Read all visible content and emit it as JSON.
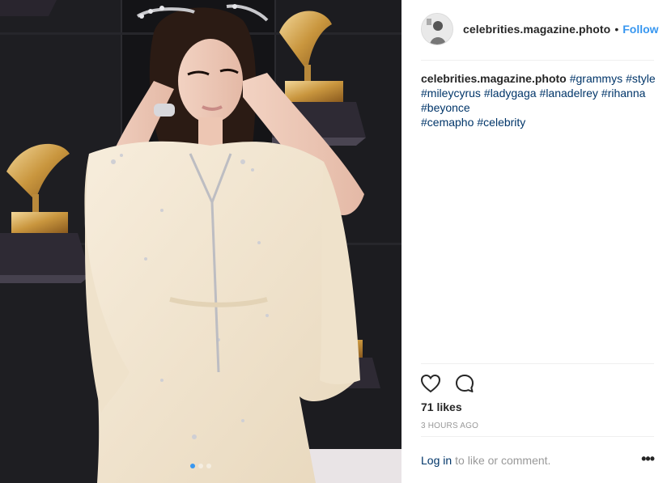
{
  "post": {
    "username": "celebrities.magazine.photo",
    "separator": "•",
    "follow_label": "Follow",
    "caption_user": "celebrities.magazine.photo",
    "hashtags": [
      "#grammys",
      "#style",
      "#mileycyrus",
      "#ladygaga",
      "#lanadelrey",
      "#rihanna",
      "#beyonce",
      "#cemapho",
      "#celebrity"
    ],
    "likes": "71 likes",
    "timestamp": "3 HOURS AGO",
    "login_label": "Log in",
    "comment_prompt": "to like or comment.",
    "more_label": "•••"
  },
  "carousel": {
    "count": 3,
    "active_index": 0
  },
  "icons": {
    "like": "heart-icon",
    "comment": "comment-icon",
    "more": "more-options-icon"
  },
  "colors": {
    "link": "#003569",
    "follow": "#3897f0",
    "text": "#262626",
    "muted": "#999999"
  }
}
